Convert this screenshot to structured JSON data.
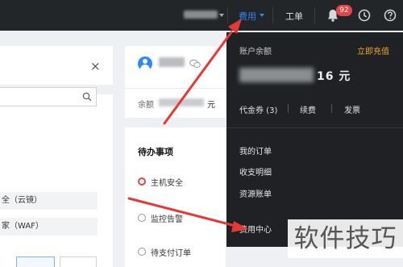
{
  "topbar": {
    "fee_menu": "费用",
    "ticket": "工单",
    "notification_count": "92",
    "icons": [
      "bell-icon",
      "clock-icon",
      "help-icon"
    ]
  },
  "left_panel": {
    "close_glyph": "×",
    "items": [
      "全（云镜）",
      "家（WAF）"
    ]
  },
  "account_card": {
    "balance_label": "余额",
    "balance_unit": "元"
  },
  "todo": {
    "title": "待办事项",
    "items": [
      "主机安全",
      "监控告警",
      "待支付订单"
    ]
  },
  "fee_dropdown": {
    "balance_label": "账户余额",
    "recharge": "立即充值",
    "balance_tail": "16 元",
    "links": [
      "代金券 (3)",
      "续费",
      "发票"
    ],
    "menu": [
      "我的订单",
      "收支明细",
      "资源账单",
      "费用中心"
    ]
  },
  "watermark": "软件技巧",
  "colors": {
    "topbar_bg": "#232629",
    "dropdown_bg": "#1f2124",
    "accent_blue": "#2f86ff",
    "recharge_orange": "#f0a830",
    "badge_red": "#e54545",
    "annotation_red": "#e53935"
  }
}
